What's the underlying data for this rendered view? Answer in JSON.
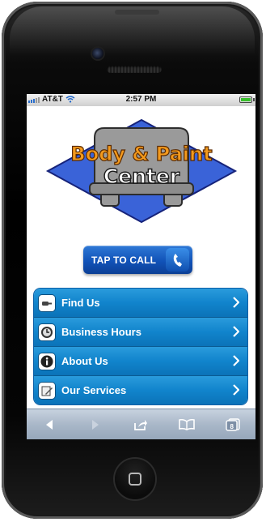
{
  "status_bar": {
    "carrier": "AT&T",
    "time": "2:57 PM"
  },
  "logo": {
    "line1": "Body & Paint",
    "line2": "Center"
  },
  "call_button": {
    "label": "TAP TO CALL"
  },
  "menu": {
    "items": [
      {
        "label": "Find Us",
        "icon": "car-key-icon"
      },
      {
        "label": "Business Hours",
        "icon": "clock-icon"
      },
      {
        "label": "About Us",
        "icon": "info-icon"
      },
      {
        "label": "Our Services",
        "icon": "paper-pencil-icon"
      }
    ]
  },
  "toolbar": {
    "tabs_count": "8"
  },
  "colors": {
    "menu_blue": "#1184cc",
    "call_blue": "#1152b8",
    "logo_orange": "#f39a1d",
    "logo_blue": "#3a63d8"
  }
}
